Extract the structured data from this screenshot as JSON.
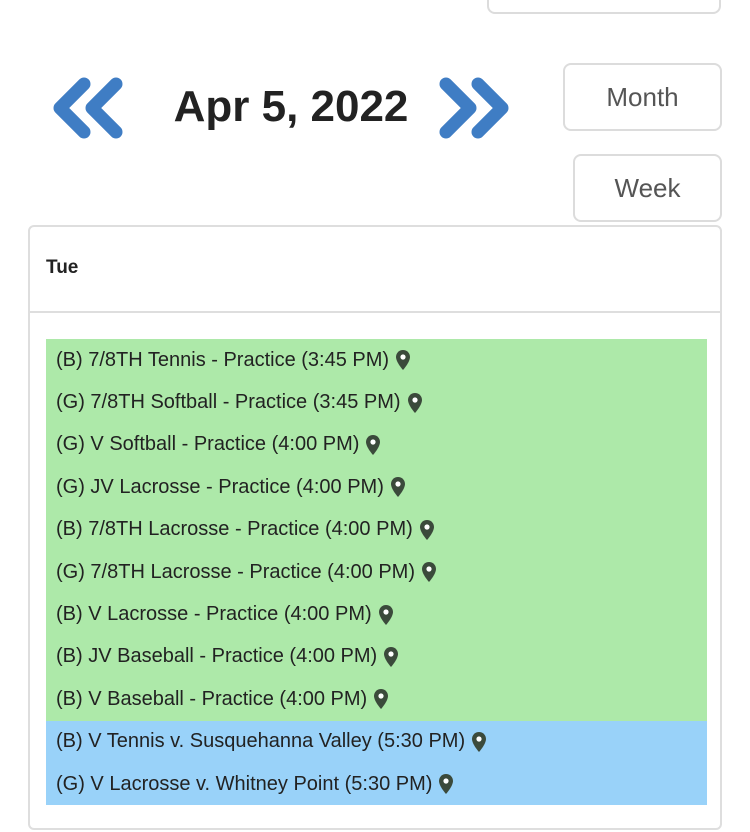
{
  "header": {
    "date": "Apr 5, 2022",
    "prev_icon": "double-chevron-left-icon",
    "next_icon": "double-chevron-right-icon"
  },
  "view_buttons": {
    "month": "Month",
    "week": "Week"
  },
  "calendar": {
    "day": "Tue",
    "events": [
      {
        "text": "(B) 7/8TH Tennis - Practice (3:45 PM)",
        "type": "practice"
      },
      {
        "text": "(G) 7/8TH Softball - Practice (3:45 PM)",
        "type": "practice"
      },
      {
        "text": "(G) V Softball - Practice (4:00 PM)",
        "type": "practice"
      },
      {
        "text": "(G) JV Lacrosse - Practice (4:00 PM)",
        "type": "practice"
      },
      {
        "text": "(B) 7/8TH Lacrosse - Practice (4:00 PM)",
        "type": "practice"
      },
      {
        "text": "(G) 7/8TH Lacrosse - Practice (4:00 PM)",
        "type": "practice"
      },
      {
        "text": "(B) V Lacrosse - Practice (4:00 PM)",
        "type": "practice"
      },
      {
        "text": "(B) JV Baseball - Practice (4:00 PM)",
        "type": "practice"
      },
      {
        "text": "(B) V Baseball - Practice (4:00 PM)",
        "type": "practice"
      },
      {
        "text": "(B) V Tennis v. Susquehanna Valley (5:30 PM)",
        "type": "game"
      },
      {
        "text": "(G) V Lacrosse v. Whitney Point (5:30 PM)",
        "type": "game"
      }
    ]
  },
  "colors": {
    "arrow": "#3f7dc4",
    "practice": "#ade9a9",
    "game": "#99d2f9",
    "pin": "#3b4a3b"
  }
}
